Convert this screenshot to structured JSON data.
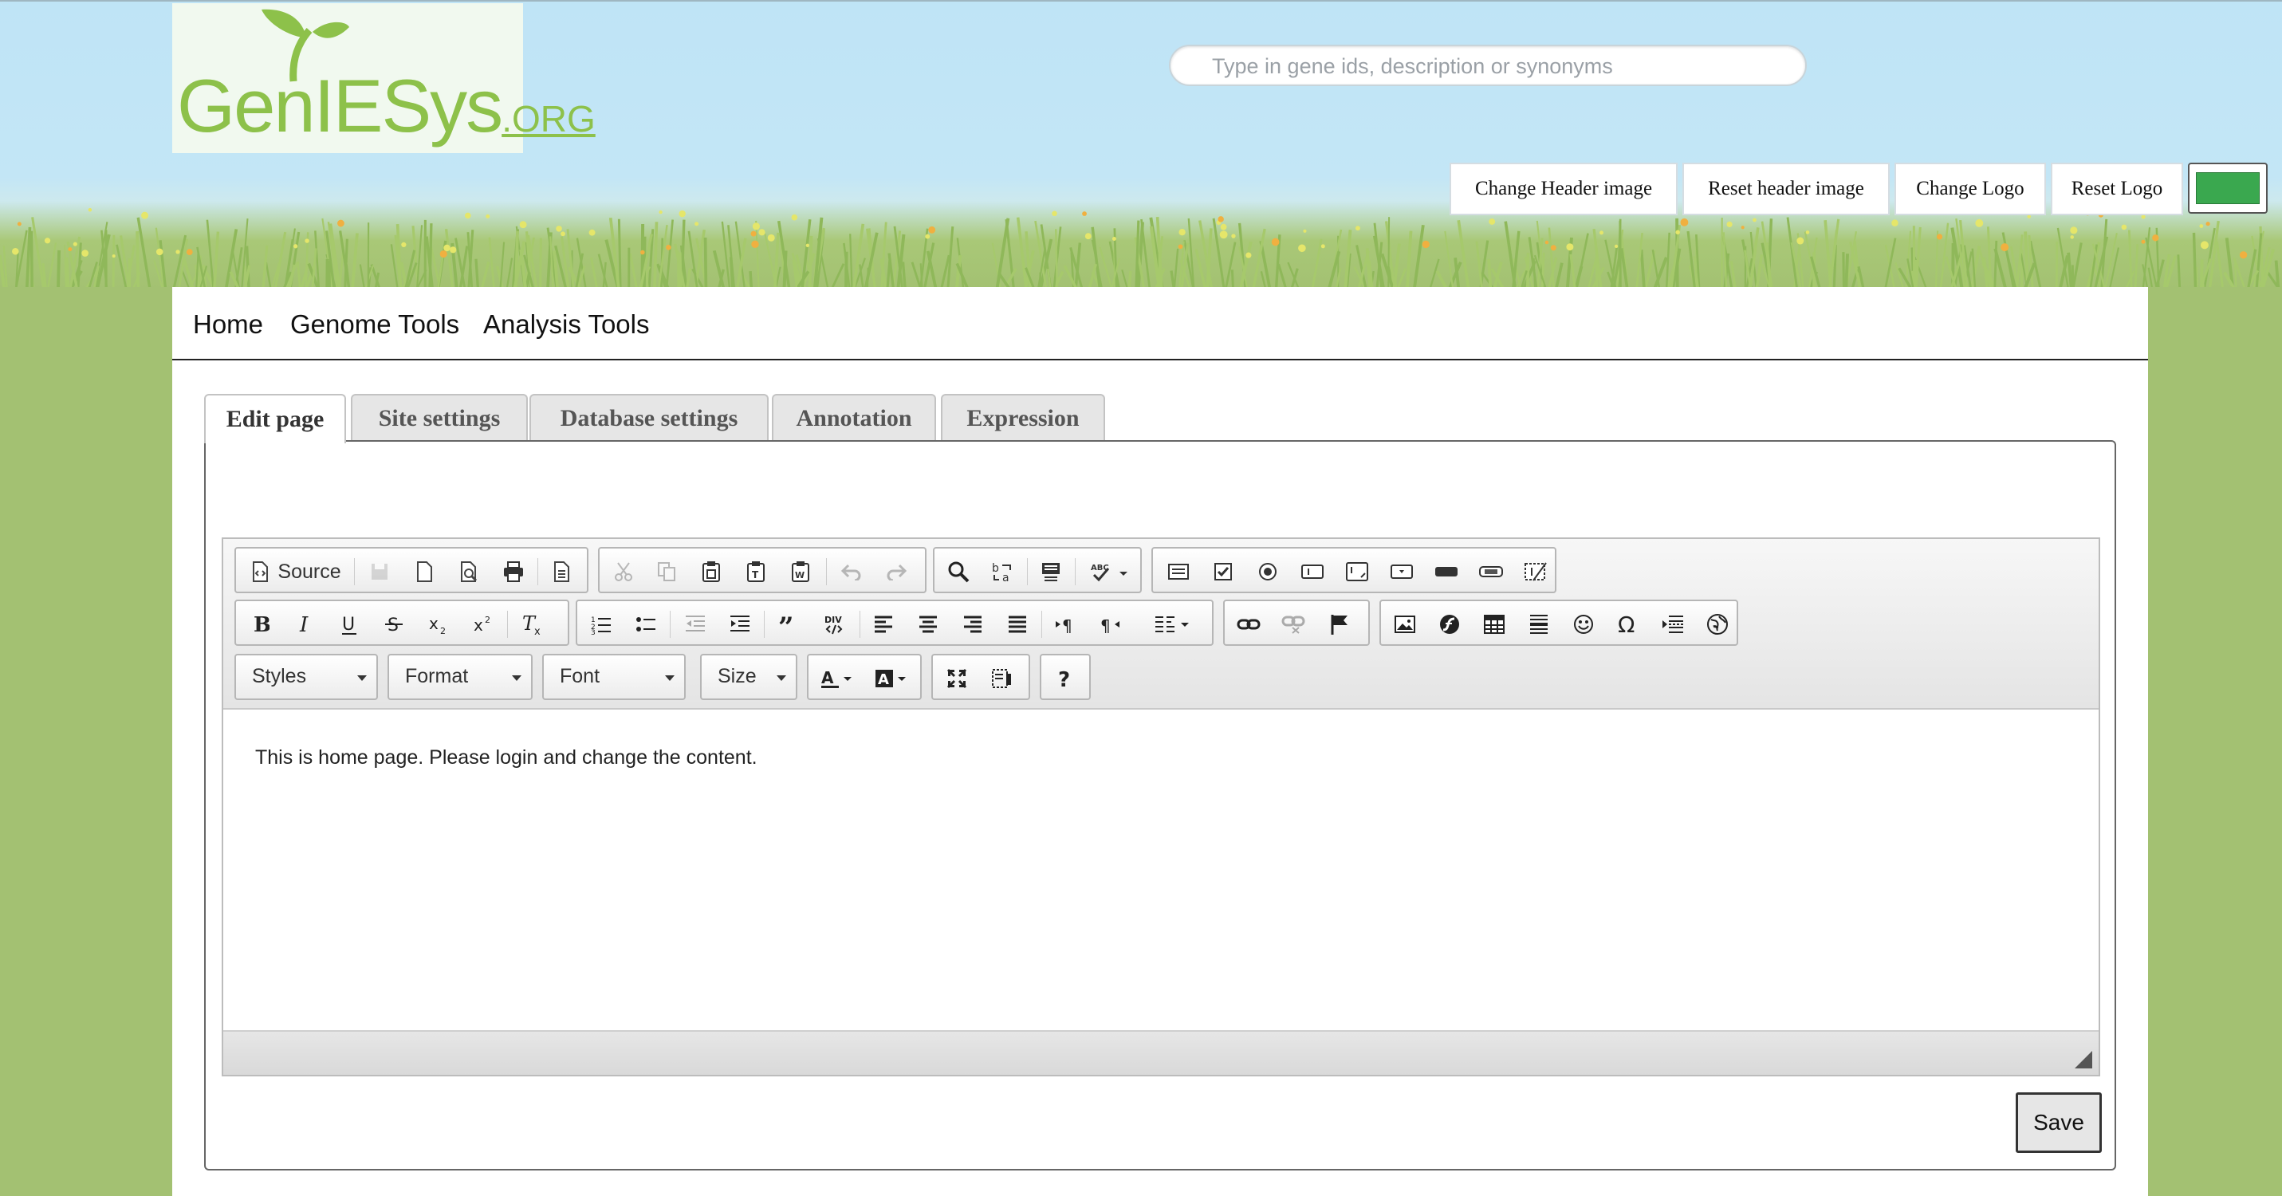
{
  "header": {
    "logo": {
      "text": "GenIESys",
      "suffix": ".ORG"
    },
    "search": {
      "placeholder": "Type in gene ids, description or synonyms",
      "value": ""
    },
    "buttons": {
      "change_header": "Change Header image",
      "reset_header": "Reset header image",
      "change_logo": "Change Logo",
      "reset_logo": "Reset Logo"
    },
    "color_swatch": "#3aa84f"
  },
  "nav": {
    "items": [
      "Home",
      "Genome Tools",
      "Analysis Tools"
    ]
  },
  "tabs": [
    {
      "label": "Edit page",
      "active": true
    },
    {
      "label": "Site settings",
      "active": false
    },
    {
      "label": "Database settings",
      "active": false
    },
    {
      "label": "Annotation",
      "active": false
    },
    {
      "label": "Expression",
      "active": false
    }
  ],
  "editor": {
    "source_label": "Source",
    "combos": {
      "styles": "Styles",
      "format": "Format",
      "font": "Font",
      "size": "Size"
    },
    "content": "This is home page. Please login and change the content.",
    "icons": {
      "row1": [
        "source-icon",
        "save-icon",
        "new-page-icon",
        "preview-icon",
        "print-icon",
        "templates-icon",
        "cut-icon",
        "copy-icon",
        "paste-icon",
        "paste-text-icon",
        "paste-word-icon",
        "undo-icon",
        "redo-icon",
        "find-icon",
        "replace-icon",
        "select-all-icon",
        "spellcheck-icon",
        "form-icon",
        "checkbox-icon",
        "radio-icon",
        "textfield-icon",
        "textarea-icon",
        "select-icon",
        "button-icon",
        "image-button-icon",
        "hidden-field-icon"
      ],
      "row2": [
        "bold-icon",
        "italic-icon",
        "underline-icon",
        "strike-icon",
        "subscript-icon",
        "superscript-icon",
        "remove-format-icon",
        "numbered-list-icon",
        "bulleted-list-icon",
        "outdent-icon",
        "indent-icon",
        "blockquote-icon",
        "div-icon",
        "align-left-icon",
        "align-center-icon",
        "align-right-icon",
        "justify-icon",
        "ltr-icon",
        "rtl-icon",
        "language-icon",
        "link-icon",
        "unlink-icon",
        "anchor-icon",
        "image-icon",
        "flash-icon",
        "table-icon",
        "horizontal-rule-icon",
        "smiley-icon",
        "special-char-icon",
        "page-break-icon",
        "iframe-icon"
      ],
      "row3": [
        "text-color-icon",
        "bg-color-icon",
        "maximize-icon",
        "show-blocks-icon",
        "about-icon"
      ]
    }
  },
  "save_label": "Save"
}
